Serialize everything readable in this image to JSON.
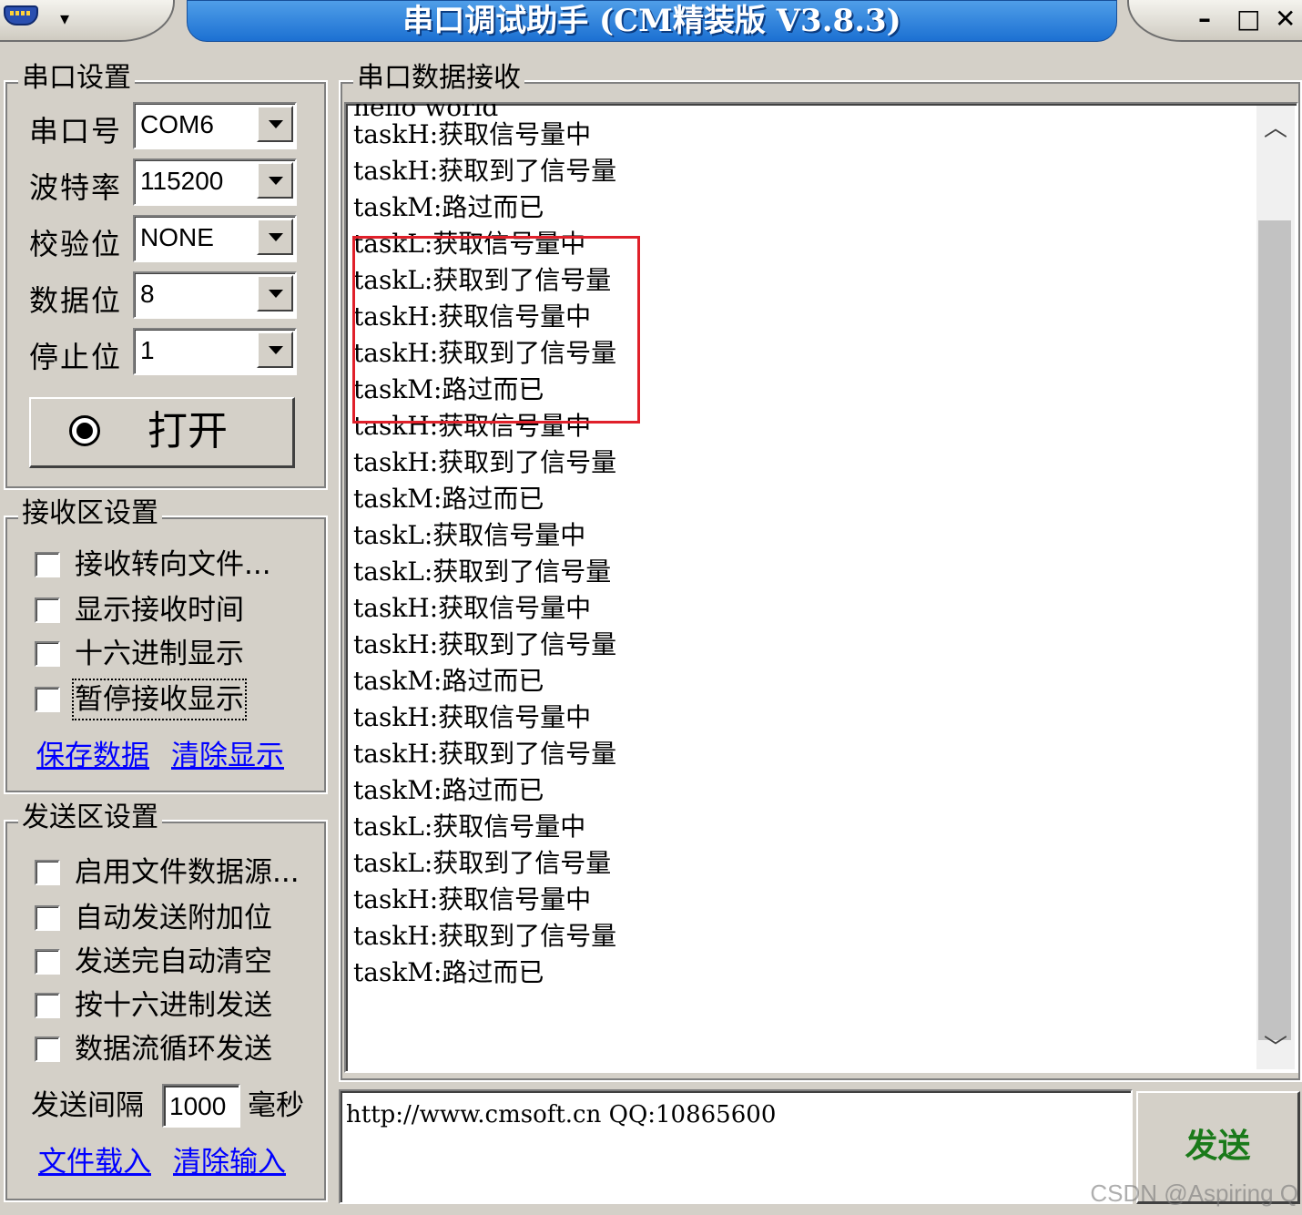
{
  "window": {
    "title": "串口调试助手 (CM精装版 V3.8.3)",
    "menu_glyph": "▾",
    "min_glyph": "–",
    "max_glyph": "□",
    "close_glyph": "✕"
  },
  "port_settings": {
    "group_title": "串口设置",
    "fields": [
      {
        "label": "串口号",
        "value": "COM6"
      },
      {
        "label": "波特率",
        "value": "115200"
      },
      {
        "label": "校验位",
        "value": "NONE"
      },
      {
        "label": "数据位",
        "value": "8"
      },
      {
        "label": "停止位",
        "value": "1"
      }
    ],
    "open_button_label": "打开"
  },
  "receive_settings": {
    "group_title": "接收区设置",
    "options": [
      "接收转向文件...",
      "显示接收时间",
      "十六进制显示",
      "暂停接收显示"
    ],
    "links": [
      "保存数据",
      "清除显示"
    ]
  },
  "send_settings": {
    "group_title": "发送区设置",
    "options": [
      "启用文件数据源...",
      "自动发送附加位",
      "发送完自动清空",
      "按十六进制发送",
      "数据流循环发送"
    ],
    "interval_label": "发送间隔",
    "interval_value": "1000",
    "interval_unit": "毫秒",
    "links": [
      "文件载入",
      "清除输入"
    ]
  },
  "receive_area": {
    "group_title": "串口数据接收",
    "partial_top_line": "hello world",
    "lines": [
      "taskH:获取信号量中",
      "taskH:获取到了信号量",
      "taskM:路过而已",
      "taskL:获取信号量中",
      "taskL:获取到了信号量",
      "taskH:获取信号量中",
      "taskH:获取到了信号量",
      "taskM:路过而已",
      "taskH:获取信号量中",
      "taskH:获取到了信号量",
      "taskM:路过而已",
      "taskL:获取信号量中",
      "taskL:获取到了信号量",
      "taskH:获取信号量中",
      "taskH:获取到了信号量",
      "taskM:路过而已",
      "taskH:获取信号量中",
      "taskH:获取到了信号量",
      "taskM:路过而已",
      "taskL:获取信号量中",
      "taskL:获取到了信号量",
      "taskH:获取信号量中",
      "taskH:获取到了信号量",
      "taskM:路过而已"
    ],
    "scroll_up_glyph": "︿",
    "scroll_down_glyph": "﹀"
  },
  "send_area": {
    "text": "http://www.cmsoft.cn QQ:10865600",
    "send_button_label": "发送"
  },
  "watermark": "CSDN @Aspiring Q",
  "colors": {
    "title_bar": "#1c70d2",
    "highlight": "#e0202a",
    "send_text": "#1a7a1a",
    "link": "#0000ff"
  }
}
